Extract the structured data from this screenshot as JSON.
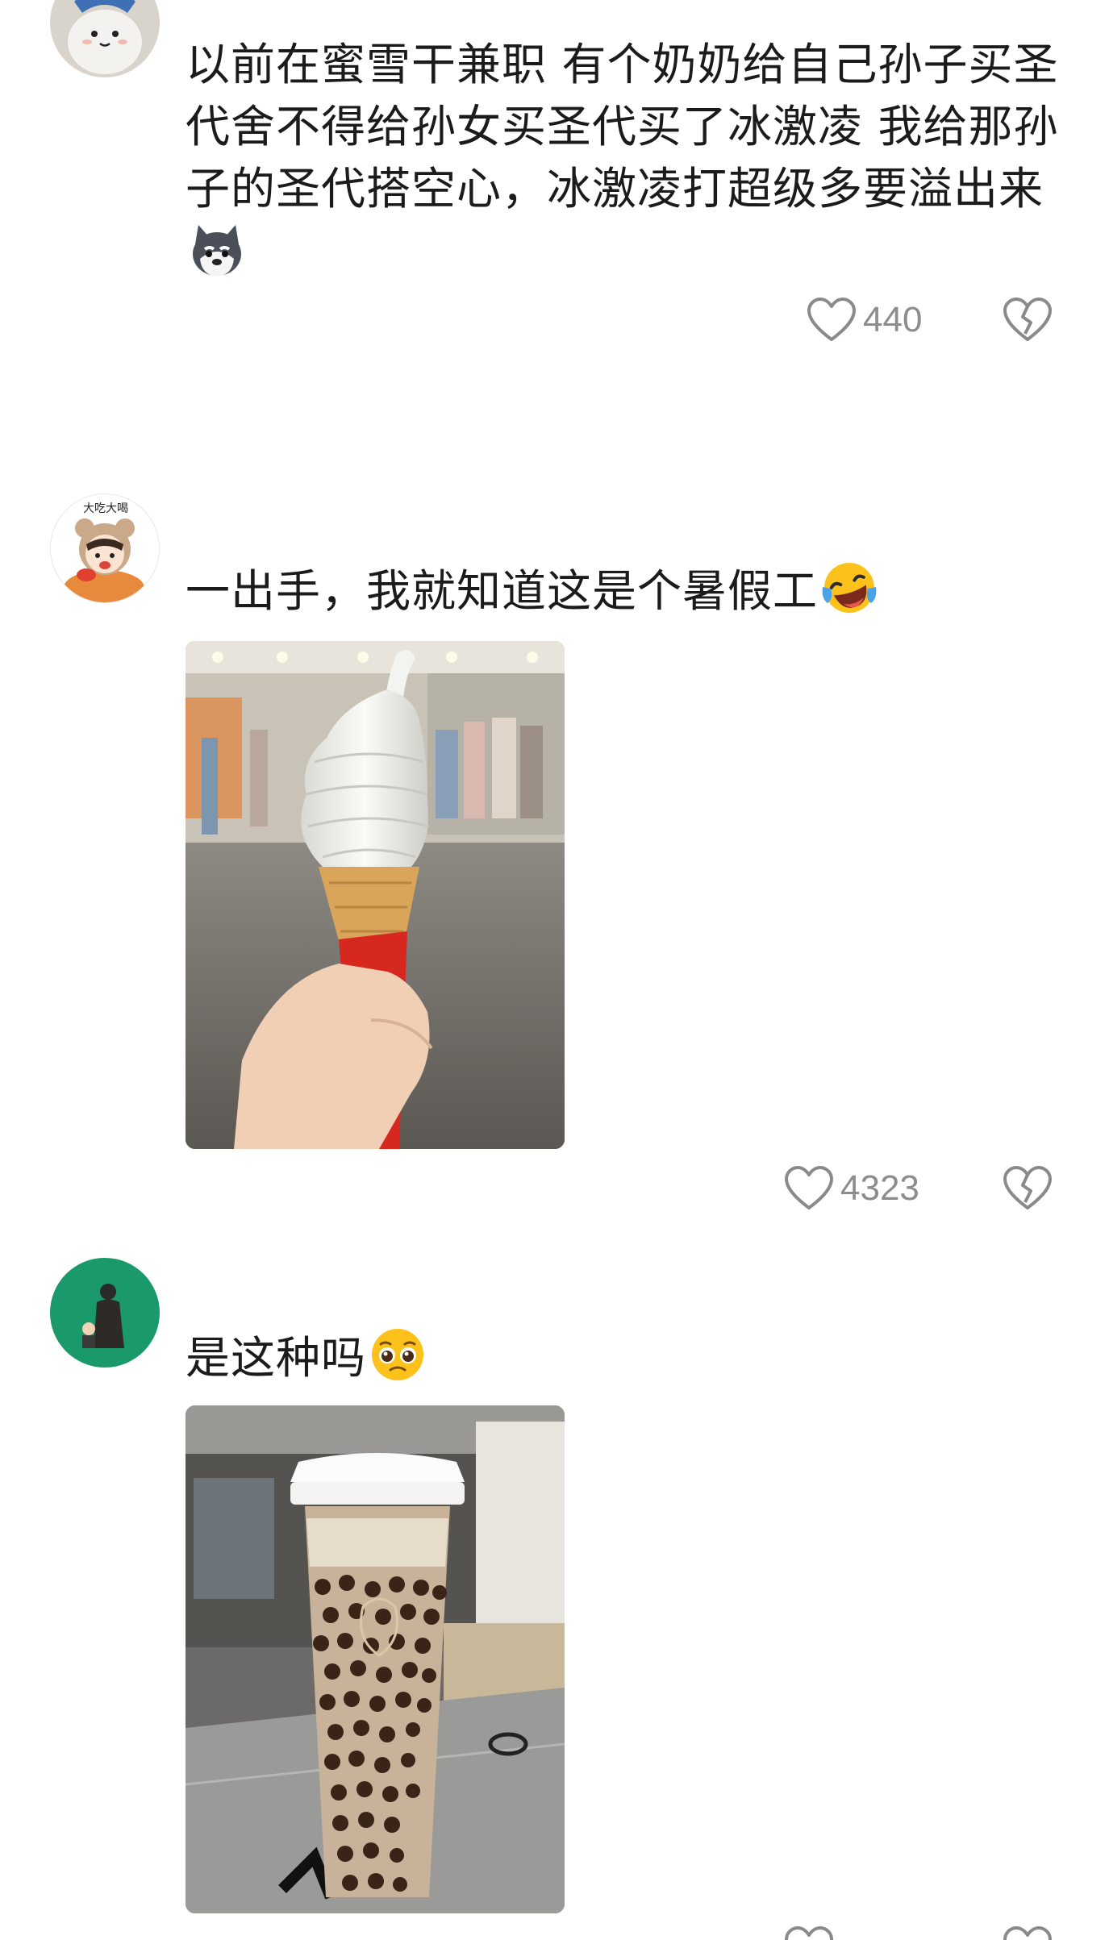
{
  "comments": [
    {
      "avatar_icon": "cartoon-cat-avatar-icon",
      "text": "以前在蜜雪干兼职 有个奶奶给自己孙子买圣代舍不得给孙女买圣代买了冰激凌 我给那孙子的圣代搭空心，冰激凌打超级多要溢出来",
      "emoji_icon": "husky-dog-emoji-icon",
      "likes": "440"
    },
    {
      "avatar_icon": "cartoon-bear-girl-avatar-icon",
      "avatar_caption": "大吃大喝",
      "text": "一出手，我就知道这是个暑假工",
      "emoji_icon": "laughing-crying-emoji-icon",
      "image_icon": "ice-cream-cone-photo",
      "likes": "4323"
    },
    {
      "avatar_icon": "green-figure-avatar-icon",
      "text": "是这种吗",
      "emoji_icon": "pleading-face-emoji-icon",
      "image_icon": "bubble-tea-cup-photo"
    }
  ],
  "colors": {
    "text": "#1b1b1b",
    "meta": "#8d8d8d",
    "avatar_green": "#1a9a6a"
  }
}
